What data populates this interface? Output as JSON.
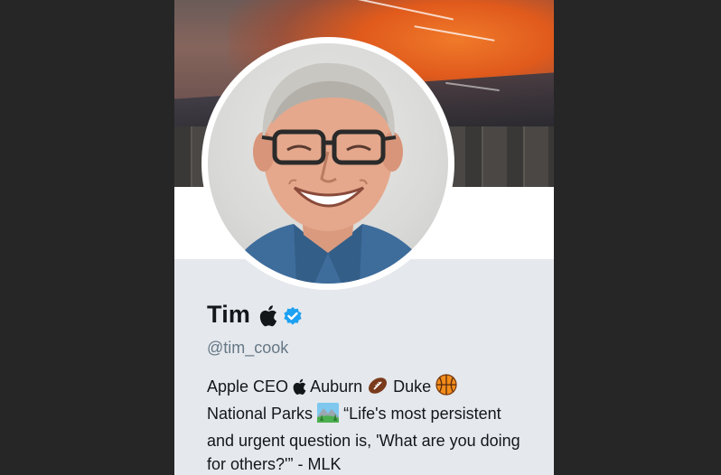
{
  "profile": {
    "name": "Tim",
    "handle": "@tim_cook",
    "verified": true,
    "icons": [
      "apple-logo-icon",
      "verified-badge-icon"
    ]
  },
  "bio": {
    "part1": "Apple CEO",
    "part2": "Auburn",
    "part3": "Duke",
    "part4": "National Parks",
    "part5": "“Life's most persistent and urgent question is, 'What are you doing for others?'” - MLK",
    "icons": [
      "apple-logo-icon",
      "football-emoji-icon",
      "basketball-emoji-icon",
      "national-park-emoji-icon"
    ]
  },
  "colors": {
    "page_background": "#262626",
    "card_background": "#e5e8ec",
    "verified_blue": "#1da1f2",
    "handle_gray": "#657786",
    "text_dark": "#14171a"
  }
}
